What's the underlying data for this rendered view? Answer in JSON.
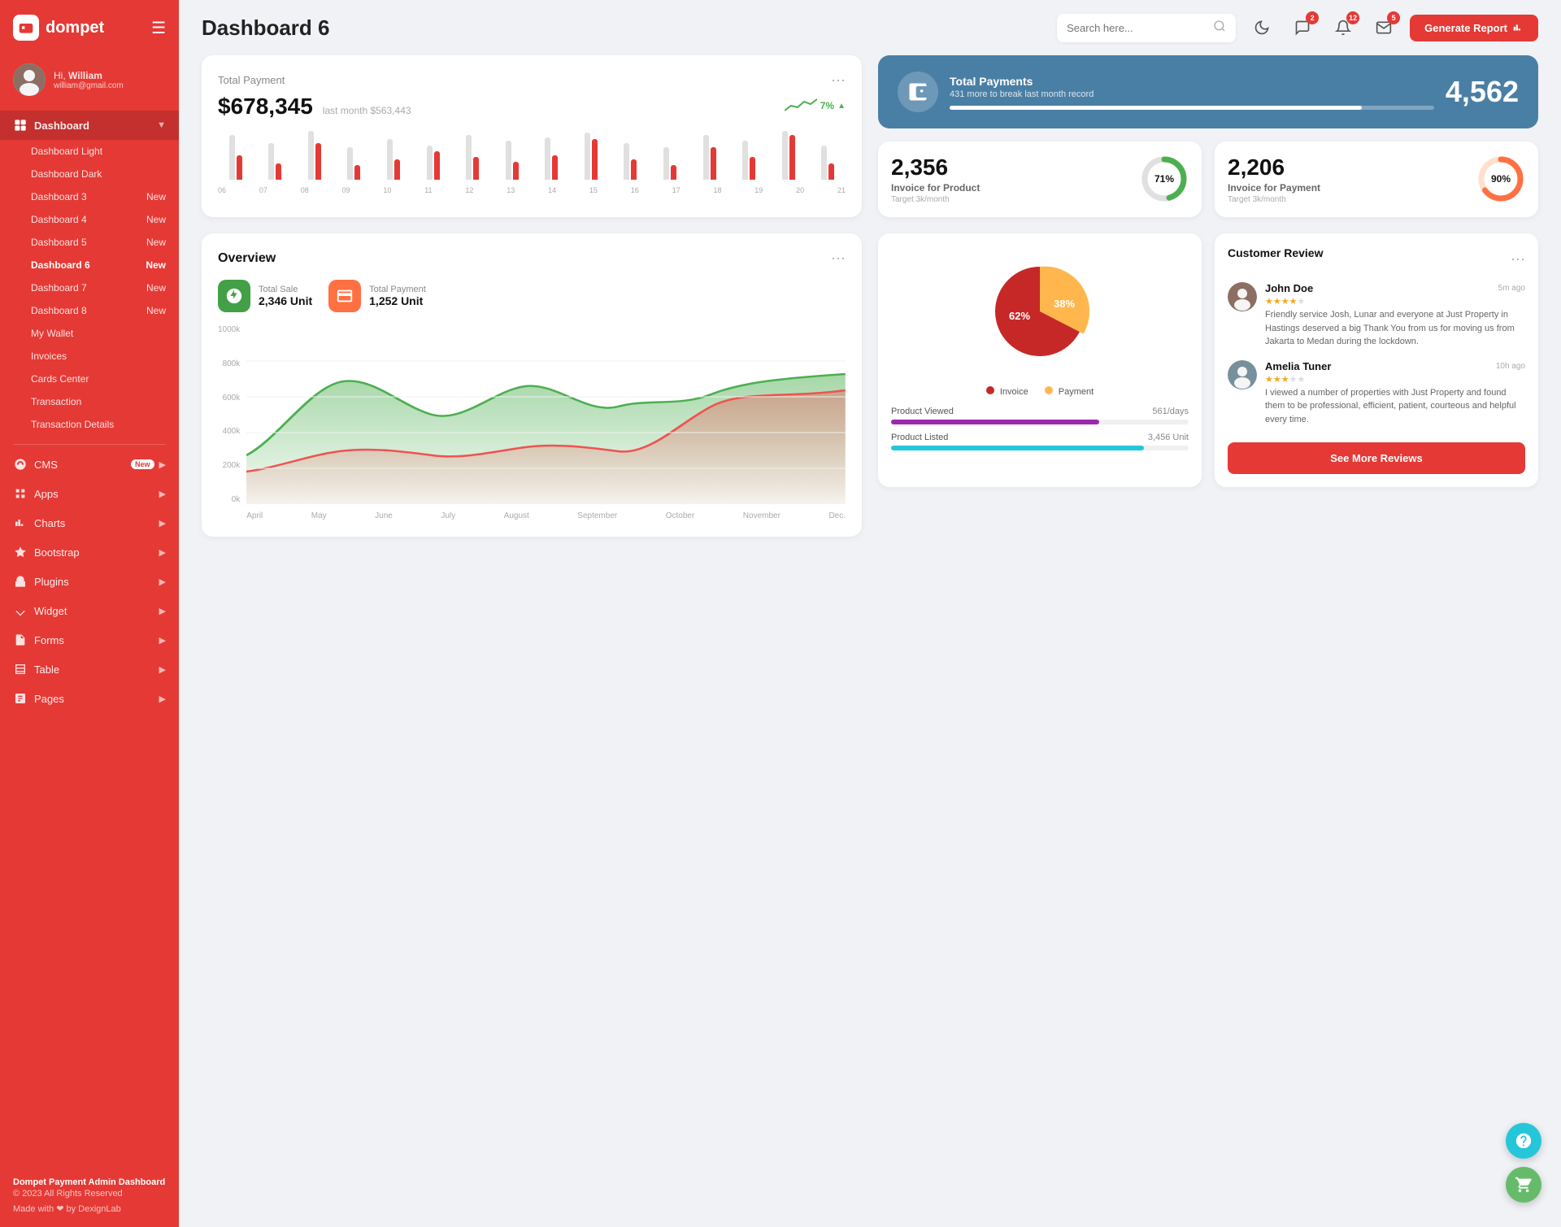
{
  "brand": {
    "name": "dompet",
    "logo_icon": "💳"
  },
  "user": {
    "greeting": "Hi,",
    "name": "William",
    "email": "william@gmail.com"
  },
  "sidebar": {
    "dashboard_label": "Dashboard",
    "items": [
      {
        "label": "Dashboard Light",
        "id": "dashboard-light"
      },
      {
        "label": "Dashboard Dark",
        "id": "dashboard-dark"
      },
      {
        "label": "Dashboard 3",
        "id": "dashboard-3",
        "badge": "New"
      },
      {
        "label": "Dashboard 4",
        "id": "dashboard-4",
        "badge": "New"
      },
      {
        "label": "Dashboard 5",
        "id": "dashboard-5",
        "badge": "New"
      },
      {
        "label": "Dashboard 6",
        "id": "dashboard-6",
        "badge": "New",
        "active": true
      },
      {
        "label": "Dashboard 7",
        "id": "dashboard-7",
        "badge": "New"
      },
      {
        "label": "Dashboard 8",
        "id": "dashboard-8",
        "badge": "New"
      },
      {
        "label": "My Wallet",
        "id": "my-wallet"
      },
      {
        "label": "Invoices",
        "id": "invoices"
      },
      {
        "label": "Cards Center",
        "id": "cards-center"
      },
      {
        "label": "Transaction",
        "id": "transaction"
      },
      {
        "label": "Transaction Details",
        "id": "transaction-details"
      }
    ],
    "nav": [
      {
        "label": "CMS",
        "id": "cms",
        "badge": "New",
        "has_arrow": true
      },
      {
        "label": "Apps",
        "id": "apps",
        "has_arrow": true
      },
      {
        "label": "Charts",
        "id": "charts",
        "has_arrow": true
      },
      {
        "label": "Bootstrap",
        "id": "bootstrap",
        "has_arrow": true
      },
      {
        "label": "Plugins",
        "id": "plugins",
        "has_arrow": true
      },
      {
        "label": "Widget",
        "id": "widget",
        "has_arrow": true
      },
      {
        "label": "Forms",
        "id": "forms",
        "has_arrow": true
      },
      {
        "label": "Table",
        "id": "table",
        "has_arrow": true
      },
      {
        "label": "Pages",
        "id": "pages",
        "has_arrow": true
      }
    ]
  },
  "topbar": {
    "title": "Dashboard 6",
    "search_placeholder": "Search here...",
    "badges": {
      "chat": 2,
      "bell": 12,
      "message": 5
    },
    "generate_btn": "Generate Report"
  },
  "total_payment": {
    "label": "Total Payment",
    "amount": "$678,345",
    "last_month_label": "last month $563,443",
    "trend": "7%",
    "bars": [
      {
        "gray": 55,
        "red": 30,
        "label": "06"
      },
      {
        "gray": 45,
        "red": 20,
        "label": "07"
      },
      {
        "gray": 60,
        "red": 45,
        "label": "08"
      },
      {
        "gray": 40,
        "red": 18,
        "label": "09"
      },
      {
        "gray": 50,
        "red": 25,
        "label": "10"
      },
      {
        "gray": 42,
        "red": 35,
        "label": "11"
      },
      {
        "gray": 55,
        "red": 28,
        "label": "12"
      },
      {
        "gray": 48,
        "red": 22,
        "label": "13"
      },
      {
        "gray": 52,
        "red": 30,
        "label": "14"
      },
      {
        "gray": 58,
        "red": 50,
        "label": "15"
      },
      {
        "gray": 45,
        "red": 25,
        "label": "16"
      },
      {
        "gray": 40,
        "red": 18,
        "label": "17"
      },
      {
        "gray": 55,
        "red": 40,
        "label": "18"
      },
      {
        "gray": 48,
        "red": 28,
        "label": "19"
      },
      {
        "gray": 60,
        "red": 55,
        "label": "20"
      },
      {
        "gray": 42,
        "red": 20,
        "label": "21"
      }
    ]
  },
  "total_payments_blue": {
    "title": "Total Payments",
    "subtitle": "431 more to break last month record",
    "value": "4,562",
    "progress": 85
  },
  "invoice_product": {
    "count": "2,356",
    "label": "Invoice for Product",
    "target": "Target 3k/month",
    "percent": 71,
    "color": "#4caf50"
  },
  "invoice_payment": {
    "count": "2,206",
    "label": "Invoice for Payment",
    "target": "Target 3k/month",
    "percent": 90,
    "color": "#ff7043"
  },
  "overview": {
    "title": "Overview",
    "total_sale_label": "Total Sale",
    "total_sale_value": "2,346 Unit",
    "total_payment_label": "Total Payment",
    "total_payment_value": "1,252 Unit",
    "y_labels": [
      "1000k",
      "800k",
      "600k",
      "400k",
      "200k",
      "0k"
    ],
    "x_labels": [
      "April",
      "May",
      "June",
      "July",
      "August",
      "September",
      "October",
      "November",
      "Dec."
    ]
  },
  "pie_chart": {
    "invoice_pct": 62,
    "payment_pct": 38,
    "invoice_label": "Invoice",
    "payment_label": "Payment",
    "invoice_color": "#c62828",
    "payment_color": "#ffb74d"
  },
  "product_stats": {
    "viewed_label": "Product Viewed",
    "viewed_value": "561/days",
    "viewed_pct": 70,
    "viewed_color": "#9c27b0",
    "listed_label": "Product Listed",
    "listed_value": "3,456 Unit",
    "listed_pct": 85,
    "listed_color": "#26c6da"
  },
  "customer_review": {
    "title": "Customer Review",
    "reviews": [
      {
        "name": "John Doe",
        "time": "5m ago",
        "stars": 4,
        "text": "Friendly service Josh, Lunar and everyone at Just Property in Hastings deserved a big Thank You from us for moving us from Jakarta to Medan during the lockdown."
      },
      {
        "name": "Amelia Tuner",
        "time": "10h ago",
        "stars": 3,
        "text": "I viewed a number of properties with Just Property and found them to be professional, efficient, patient, courteous and helpful every time."
      }
    ],
    "see_more_btn": "See More Reviews"
  },
  "footer": {
    "title": "Dompet Payment Admin Dashboard",
    "copy": "© 2023 All Rights Reserved",
    "made": "Made with ❤ by DexignLab"
  }
}
